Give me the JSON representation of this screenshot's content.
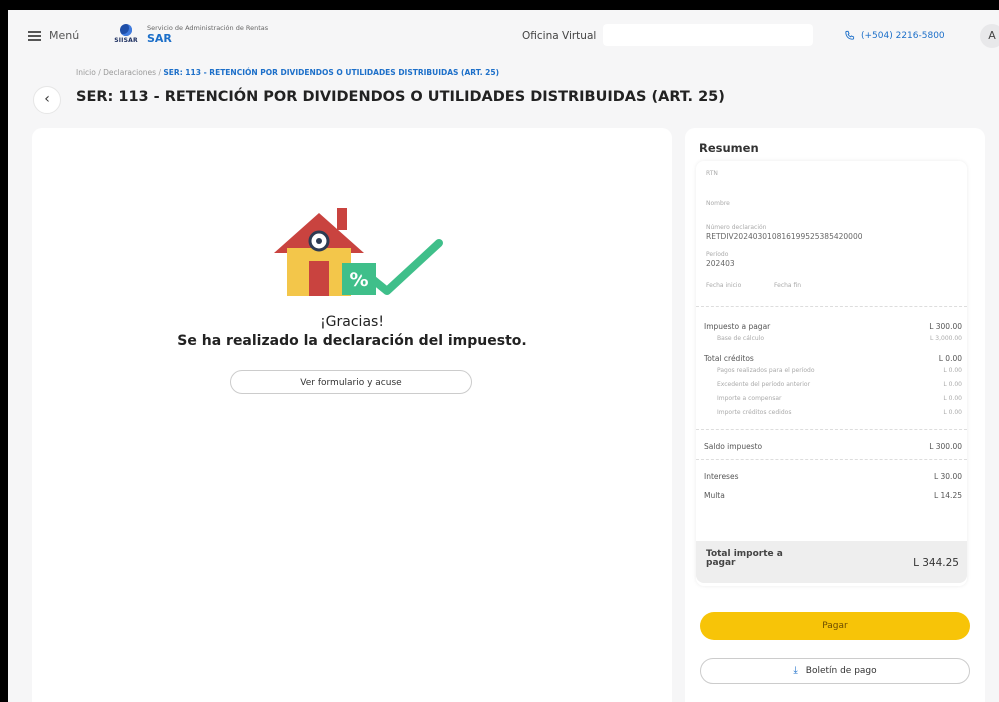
{
  "header": {
    "menu_label": "Menú",
    "logo_sigla": "SIISAR",
    "org_name": "Servicio de Administración de Rentas",
    "brand": "SAR",
    "center_title": "Oficina Virtual",
    "phone": "(+504) 2216-5800",
    "avatar_letter": "A"
  },
  "breadcrumb": {
    "path": "Inicio / Declaraciones /",
    "current": "SER: 113 - RETENCIÓN POR DIVIDENDOS O UTILIDADES DISTRIBUIDAS (ART. 25)"
  },
  "page_title": "SER: 113 - RETENCIÓN POR DIVIDENDOS O UTILIDADES DISTRIBUIDAS (ART. 25)",
  "success": {
    "title": "¡Gracias!",
    "message": "Se ha realizado la declaración del impuesto.",
    "view_button": "Ver formulario y acuse"
  },
  "summary": {
    "title": "Resumen",
    "rtn_label": "RTN",
    "nombre_label": "Nombre",
    "numero_label": "Número declaración",
    "numero_value": "RETDIV202403010816199525385420000",
    "periodo_label": "Período",
    "periodo_value": "202403",
    "fecha_inicio_label": "Fecha inicio",
    "fecha_fin_label": "Fecha fin",
    "impuesto_label": "Impuesto a pagar",
    "impuesto_value": "L 300.00",
    "base_label": "Base de cálculo",
    "base_value": "L 3,000.00",
    "creditos_label": "Total créditos",
    "creditos_value": "L 0.00",
    "credit_lines": [
      {
        "label": "Pagos realizados para el período",
        "value": "L 0.00"
      },
      {
        "label": "Excedente del período anterior",
        "value": "L 0.00"
      },
      {
        "label": "Importe a compensar",
        "value": "L 0.00"
      },
      {
        "label": "Importe créditos cedidos",
        "value": "L 0.00"
      }
    ],
    "saldo_label": "Saldo impuesto",
    "saldo_value": "L 300.00",
    "intereses_label": "Intereses",
    "intereses_value": "L 30.00",
    "multa_label": "Multa",
    "multa_value": "L 14.25",
    "total_label": "Total importe a pagar",
    "total_value": "L 344.25"
  },
  "actions": {
    "pay": "Pagar",
    "boletin": "Boletín de pago"
  },
  "colors": {
    "accent_blue": "#1c6fc9",
    "pay_yellow": "#f7c408",
    "check_green": "#3fbf8a"
  }
}
